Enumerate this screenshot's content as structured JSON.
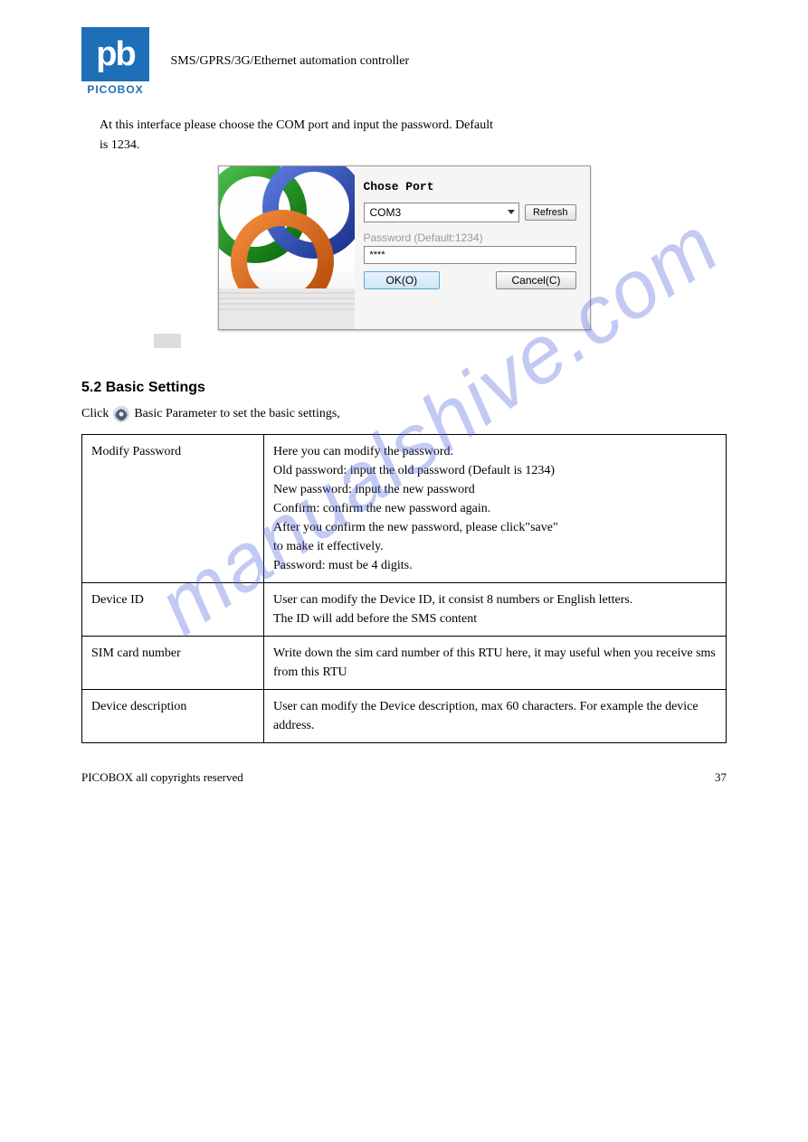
{
  "logo": {
    "mark": "pb",
    "name": "PICOBOX"
  },
  "header": {
    "title": "SMS/GPRS/3G/Ethernet automation controller"
  },
  "intro": {
    "line1": "At this interface please choose the COM port and input the password. Default",
    "line2": "is 1234."
  },
  "dialog": {
    "title": "Chose Port",
    "port_value": "COM3",
    "refresh_label": "Refresh",
    "password_label": "Password  (Default:1234)",
    "password_value": "****",
    "ok_label": "OK(O)",
    "cancel_label": "Cancel(C)"
  },
  "sections": {
    "basic_settings": {
      "heading": "5.2 Basic Settings",
      "sub_prefix": "Click ",
      "sub_suffix": " Basic Parameter to set the basic settings,"
    }
  },
  "table": {
    "rows": [
      {
        "item": "Modify Password",
        "details_lines": [
          "Here you can modify the password.",
          "Old password: input the old password (Default is 1234)",
          "New password: input the new password",
          "Confirm: confirm the new password again.",
          "After you confirm the new password, please click\"save\"",
          "to make it effectively.",
          "Password: must be 4 digits."
        ]
      },
      {
        "item": "Device ID",
        "details_lines": [
          "User can modify the Device ID, it consist 8 numbers or English letters.",
          "The ID will add before the SMS content"
        ]
      },
      {
        "item": "SIM card number",
        "details_lines": [
          "Write down the sim card number of this RTU here, it may useful when you receive sms from this RTU"
        ]
      },
      {
        "item": "Device description",
        "details_lines": [
          "User can modify the Device description, max 60 characters. For example the device address."
        ]
      }
    ]
  },
  "footer": {
    "copyright": "PICOBOX all copyrights reserved",
    "page": "37"
  },
  "watermark": "manualshive.com"
}
